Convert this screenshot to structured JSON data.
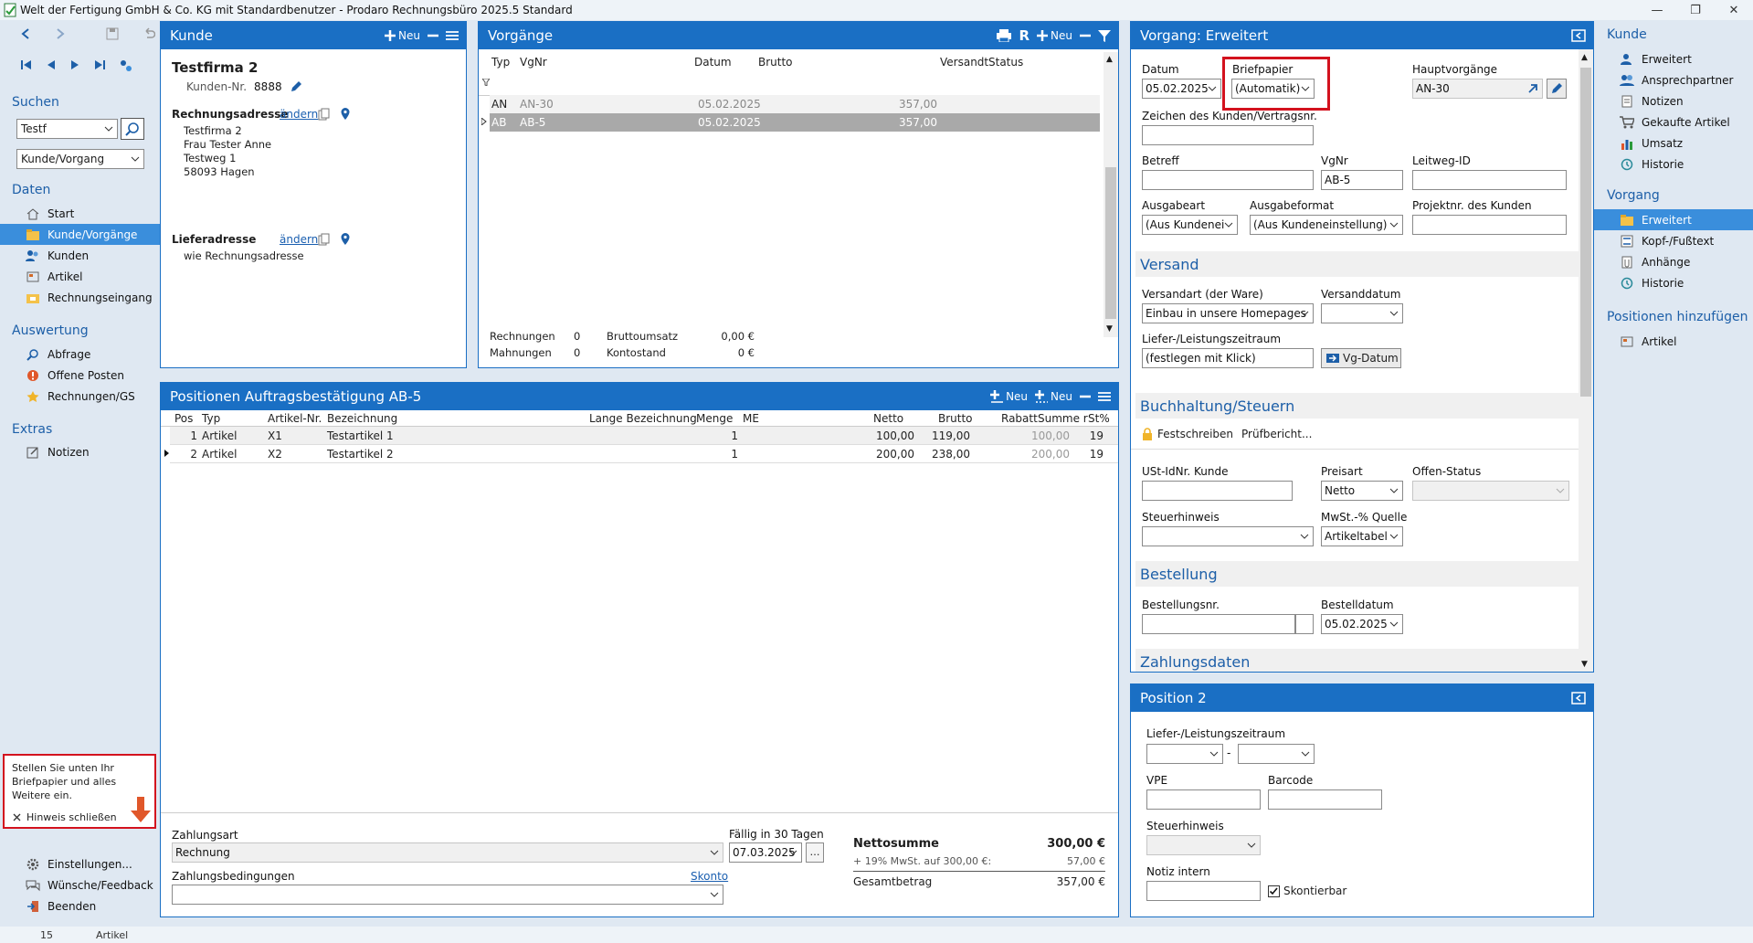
{
  "window": {
    "title": "Welt der Fertigung GmbH & Co. KG mit Standardbenutzer  -  Prodaro Rechnungsbüro 2025.5 Standard"
  },
  "left": {
    "search_title": "Suchen",
    "search_value": "Testf",
    "search_scope": "Kunde/Vorgang",
    "daten_title": "Daten",
    "daten": [
      "Start",
      "Kunde/Vorgänge",
      "Kunden",
      "Artikel",
      "Rechnungseingang"
    ],
    "auswertung_title": "Auswertung",
    "auswertung": [
      "Abfrage",
      "Offene Posten",
      "Rechnungen/GS"
    ],
    "extras_title": "Extras",
    "extras": [
      "Notizen"
    ],
    "hint_text": "Stellen Sie unten Ihr Briefpapier und alles Weitere ein.",
    "hint_close": "Hinweis schließen",
    "bottom": [
      "Einstellungen...",
      "Wünsche/Feedback",
      "Beenden"
    ]
  },
  "kunde": {
    "header": "Kunde",
    "new": "Neu",
    "name": "Testfirma 2",
    "nr_label": "Kunden-Nr.",
    "nr": "8888",
    "rechnung_label": "Rechnungsadresse",
    "change": "ändern",
    "address": [
      "Testfirma 2",
      "Frau Tester Anne",
      "Testweg 1",
      "58093 Hagen"
    ],
    "liefer_label": "Lieferadresse",
    "liefer_value": "wie Rechnungsadresse"
  },
  "vorgaenge": {
    "header": "Vorgänge",
    "new": "Neu",
    "cols": [
      "Typ",
      "VgNr",
      "Datum",
      "Brutto",
      "Versandt",
      "Status"
    ],
    "rows": [
      {
        "typ": "AN",
        "nr": "AN-30",
        "datum": "05.02.2025",
        "brutto": "357,00"
      },
      {
        "typ": "AB",
        "nr": "AB-5",
        "datum": "05.02.2025",
        "brutto": "357,00"
      }
    ],
    "footer": {
      "rechnungen_label": "Rechnungen",
      "rechnungen": "0",
      "mahnungen_label": "Mahnungen",
      "mahnungen": "0",
      "umsatz_label": "Bruttoumsatz",
      "umsatz": "0,00 €",
      "konto_label": "Kontostand",
      "konto": "0 €"
    }
  },
  "positionen": {
    "header": "Positionen Auftragsbestätigung AB-5",
    "new1": "Neu",
    "new2": "Neu",
    "cols": [
      "Pos",
      "Typ",
      "Artikel-Nr.",
      "Bezeichnung",
      "Lange Bezeichnung",
      "Menge",
      "ME",
      "Netto",
      "Brutto",
      "Rabatt",
      "Summe r",
      "St%"
    ],
    "rows": [
      {
        "pos": "1",
        "typ": "Artikel",
        "nr": "X1",
        "bez": "Testartikel 1",
        "menge": "1",
        "netto": "100,00",
        "brutto": "119,00",
        "summe": "100,00",
        "st": "19"
      },
      {
        "pos": "2",
        "typ": "Artikel",
        "nr": "X2",
        "bez": "Testartikel 2",
        "menge": "1",
        "netto": "200,00",
        "brutto": "238,00",
        "summe": "200,00",
        "st": "19"
      }
    ],
    "zahlungsart_label": "Zahlungsart",
    "zahlungsart": "Rechnung",
    "faellig_label": "Fällig in 30 Tagen",
    "faellig": "07.03.2025",
    "bedingungen_label": "Zahlungsbedingungen",
    "skonto": "Skonto",
    "netto_label": "Nettosumme",
    "netto": "300,00  €",
    "mwst_label": "+ 19% MwSt. auf 300,00 €:",
    "mwst": "57,00  €",
    "gesamt_label": "Gesamtbetrag",
    "gesamt": "357,00  €"
  },
  "vorgang": {
    "header": "Vorgang: Erweitert",
    "datum_label": "Datum",
    "datum": "05.02.2025",
    "brief_label": "Briefpapier",
    "brief": "(Automatik)",
    "haupt_label": "Hauptvorgänge",
    "haupt": "AN-30",
    "zeichen_label": "Zeichen des Kunden/Vertragsnr.",
    "betreff_label": "Betreff",
    "vgnr_label": "VgNr",
    "vgnr": "AB-5",
    "leitweg_label": "Leitweg-ID",
    "ausgabeart_label": "Ausgabeart",
    "ausgabeart": "(Aus Kundeneir",
    "ausgabeformat_label": "Ausgabeformat",
    "ausgabeformat": "(Aus Kundeneinstellung)",
    "projekt_label": "Projektnr. des Kunden",
    "versand_title": "Versand",
    "versandart_label": "Versandart (der Ware)",
    "versandart": "Einbau in unsere Homepages",
    "versanddatum_label": "Versanddatum",
    "liefer_label": "Liefer-/Leistungszeitraum",
    "liefer": "(festlegen mit Klick)",
    "vgdatum": "Vg-Datum",
    "buch_title": "Buchhaltung/Steuern",
    "fest": "Festschreiben",
    "pruef": "Prüfbericht...",
    "ust_label": "USt-IdNr. Kunde",
    "preisart_label": "Preisart",
    "preisart": "Netto",
    "offen_label": "Offen-Status",
    "steuer_label": "Steuerhinweis",
    "mwstq_label": "MwSt.-% Quelle",
    "mwstq": "Artikeltabelle",
    "bestell_title": "Bestellung",
    "bestellnr_label": "Bestellungsnr.",
    "bestelldatum_label": "Bestelldatum",
    "bestelldatum": "05.02.2025",
    "zahl_title": "Zahlungsdaten"
  },
  "position2": {
    "header": "Position 2",
    "liefer_label": "Liefer-/Leistungszeitraum",
    "dash": "-",
    "vpe_label": "VPE",
    "barcode_label": "Barcode",
    "steuer_label": "Steuerhinweis",
    "notiz_label": "Notiz intern",
    "skonto_label": "Skontierbar"
  },
  "right": {
    "kunde_title": "Kunde",
    "kunde": [
      "Erweitert",
      "Ansprechpartner",
      "Notizen",
      "Gekaufte Artikel",
      "Umsatz",
      "Historie"
    ],
    "vorgang_title": "Vorgang",
    "vorgang": [
      "Erweitert",
      "Kopf-/Fußtext",
      "Anhänge",
      "Historie"
    ],
    "pos_title": "Positionen hinzufügen",
    "pos": [
      "Artikel"
    ]
  },
  "status": {
    "count": "15",
    "type": "Artikel"
  },
  "colors": {
    "accent": "#1a6fc4",
    "selected": "#3a8edc",
    "highlight": "#d3121e"
  }
}
